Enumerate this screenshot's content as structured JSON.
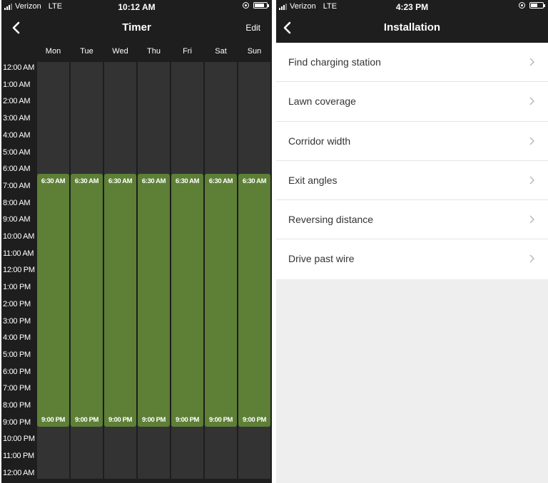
{
  "timer_screen": {
    "status": {
      "carrier": "Verizon",
      "network": "LTE",
      "time": "10:12 AM"
    },
    "nav": {
      "title": "Timer",
      "edit_label": "Edit"
    },
    "days": [
      "Mon",
      "Tue",
      "Wed",
      "Thu",
      "Fri",
      "Sat",
      "Sun"
    ],
    "hours": [
      "12:00 AM",
      "1:00 AM",
      "2:00 AM",
      "3:00 AM",
      "4:00 AM",
      "5:00 AM",
      "6:00 AM",
      "7:00 AM",
      "8:00 AM",
      "9:00 AM",
      "10:00 AM",
      "11:00 AM",
      "12:00 PM",
      "1:00 PM",
      "2:00 PM",
      "3:00 PM",
      "4:00 PM",
      "5:00 PM",
      "6:00 PM",
      "7:00 PM",
      "8:00 PM",
      "9:00 PM",
      "10:00 PM",
      "11:00 PM",
      "12:00 AM"
    ],
    "schedule": [
      {
        "day": "Mon",
        "start": "6:30 AM",
        "end": "9:00 PM"
      },
      {
        "day": "Tue",
        "start": "6:30 AM",
        "end": "9:00 PM"
      },
      {
        "day": "Wed",
        "start": "6:30 AM",
        "end": "9:00 PM"
      },
      {
        "day": "Thu",
        "start": "6:30 AM",
        "end": "9:00 PM"
      },
      {
        "day": "Fri",
        "start": "6:30 AM",
        "end": "9:00 PM"
      },
      {
        "day": "Sat",
        "start": "6:30 AM",
        "end": "9:00 PM"
      },
      {
        "day": "Sun",
        "start": "6:30 AM",
        "end": "9:00 PM"
      }
    ],
    "colors": {
      "background": "#1e1e1e",
      "column": "#333333",
      "active_block": "#5d7f36"
    }
  },
  "installation_screen": {
    "status": {
      "carrier": "Verizon",
      "network": "LTE",
      "time": "4:23 PM"
    },
    "nav": {
      "title": "Installation"
    },
    "items": [
      {
        "label": "Find charging station"
      },
      {
        "label": "Lawn coverage"
      },
      {
        "label": "Corridor width"
      },
      {
        "label": "Exit angles"
      },
      {
        "label": "Reversing distance"
      },
      {
        "label": "Drive past wire"
      }
    ]
  }
}
